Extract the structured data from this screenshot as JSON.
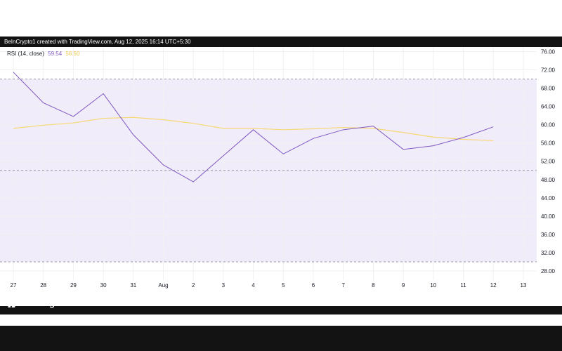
{
  "header": {
    "attribution": "BeInCrypto1 created with TradingView.com, Aug 12, 2025 16:14 UTC+5:30"
  },
  "legend": {
    "indicator": "RSI (14, close)",
    "rsi_value": "59.54",
    "ma_value": "56.50"
  },
  "footer": {
    "logo_text": "TradingView"
  },
  "colors": {
    "rsi_line": "#7e57c2",
    "ma_line": "#f7d774",
    "band_fill": "#f1ecfa",
    "dashed_level": "#9598a1",
    "grid": "#f0f1f3",
    "axis_text": "#131722"
  },
  "chart_data": {
    "type": "line",
    "x": [
      "27",
      "28",
      "29",
      "30",
      "31",
      "Aug",
      "2",
      "3",
      "4",
      "5",
      "6",
      "7",
      "8",
      "9",
      "10",
      "11",
      "12",
      "13"
    ],
    "ylim": [
      26.0,
      77.0
    ],
    "y_ticks": [
      "76.00",
      "72.00",
      "68.00",
      "64.00",
      "60.00",
      "56.00",
      "52.00",
      "48.00",
      "44.00",
      "40.00",
      "36.00",
      "32.00",
      "28.00"
    ],
    "levels": {
      "upper": 70,
      "middle": 50,
      "lower": 30
    },
    "series": [
      {
        "name": "RSI",
        "values": [
          71.5,
          64.8,
          61.8,
          66.8,
          57.8,
          51.2,
          47.5,
          53.2,
          58.9,
          53.6,
          57.0,
          58.9,
          59.7,
          54.6,
          55.4,
          57.2,
          59.54,
          null
        ]
      },
      {
        "name": "MA",
        "values": [
          59.2,
          59.9,
          60.4,
          61.4,
          61.6,
          61.1,
          60.3,
          59.2,
          59.2,
          58.9,
          59.1,
          59.4,
          59.2,
          58.3,
          57.3,
          56.8,
          56.5,
          null
        ]
      }
    ],
    "grid": true
  }
}
